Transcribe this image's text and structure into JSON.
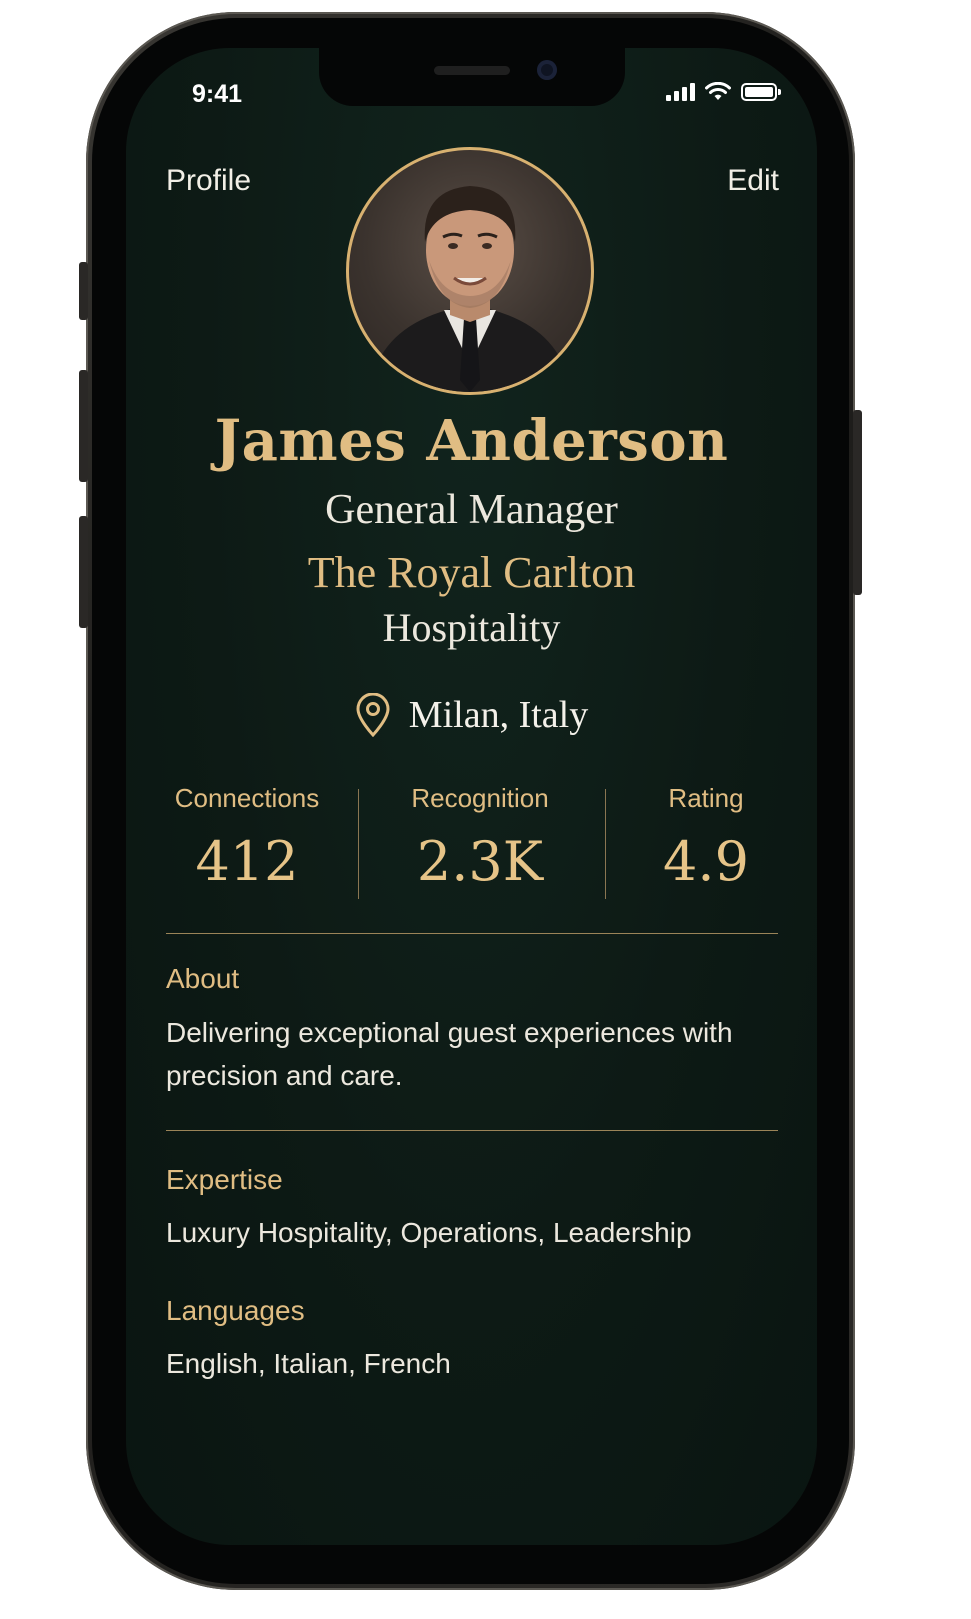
{
  "status_bar": {
    "time": "9:41",
    "icons": [
      "signal-icon",
      "wifi-icon",
      "battery-icon"
    ]
  },
  "nav": {
    "title": "Profile",
    "edit_label": "Edit"
  },
  "profile": {
    "name": "James Anderson",
    "role": "General Manager",
    "company": "The Royal Carlton",
    "industry": "Hospitality",
    "location": "Milan, Italy",
    "location_icon": "location-pin-icon"
  },
  "stats": [
    {
      "label": "Connections",
      "value": "412"
    },
    {
      "label": "Recognition",
      "value": "2.3K"
    },
    {
      "label": "Rating",
      "value": "4.9"
    }
  ],
  "about": {
    "title": "About",
    "text": "Delivering exceptional guest experiences with precision and care."
  },
  "expertise": {
    "title": "Expertise",
    "text": "Luxury Hospitality, Operations, Leadership"
  },
  "languages": {
    "title": "Languages",
    "text": "English, Italian, French"
  },
  "colors": {
    "background": "#0d1a15",
    "accent_gold": "#e0bd83",
    "text_light": "#ece8de"
  }
}
